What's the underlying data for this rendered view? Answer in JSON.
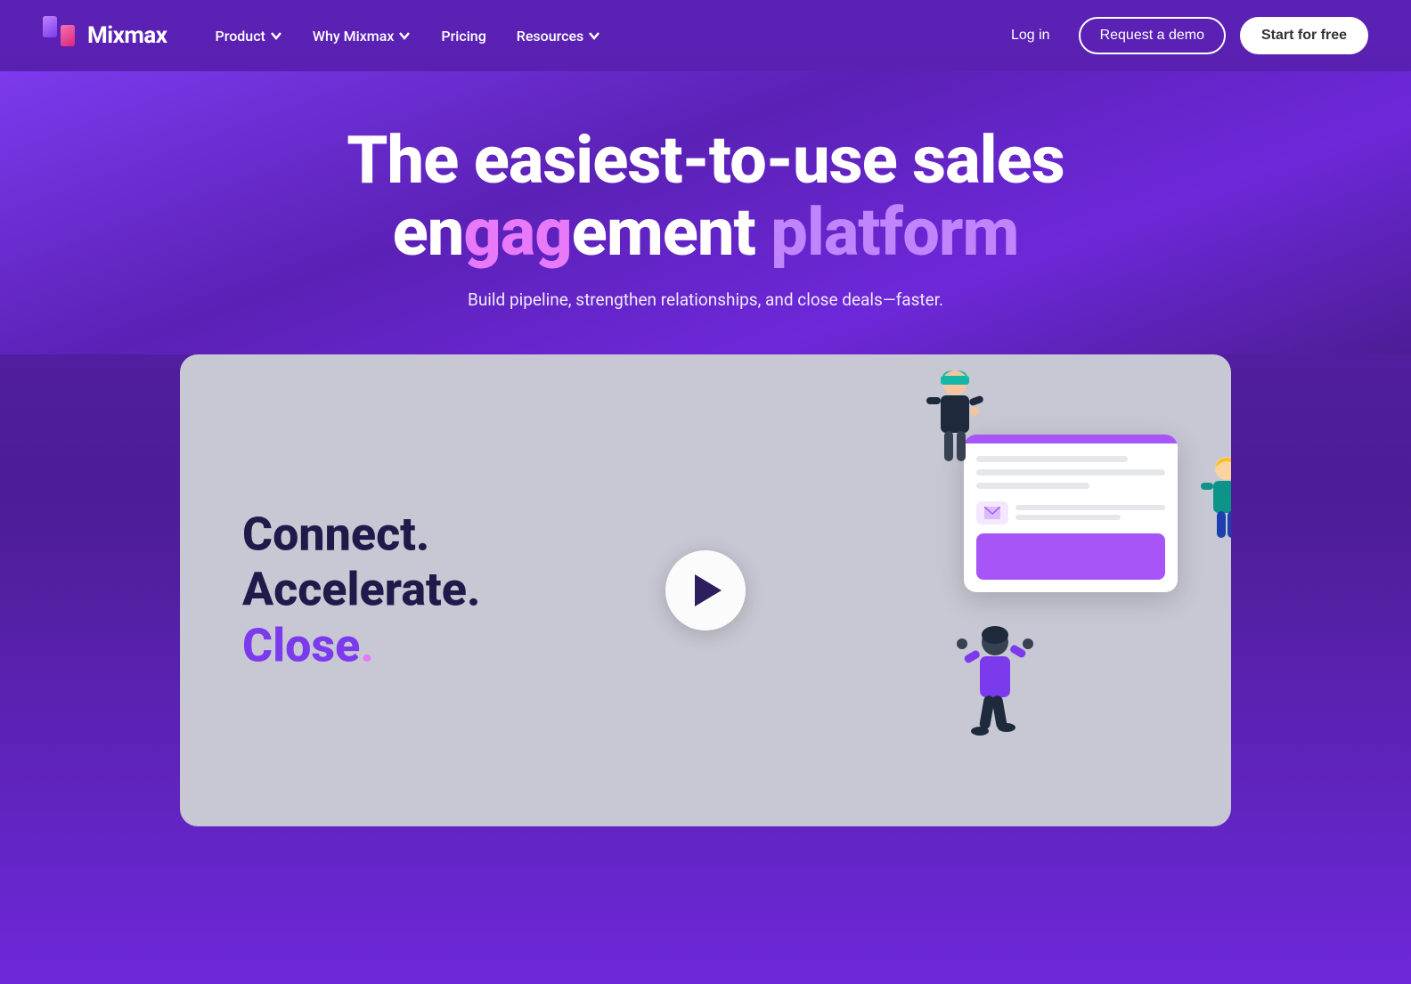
{
  "brand": {
    "name": "Mixmax",
    "logo_alt": "Mixmax logo"
  },
  "nav": {
    "links": [
      {
        "id": "product",
        "label": "Product",
        "hasDropdown": true
      },
      {
        "id": "why-mixmax",
        "label": "Why Mixmax",
        "hasDropdown": true
      },
      {
        "id": "pricing",
        "label": "Pricing",
        "hasDropdown": false
      },
      {
        "id": "resources",
        "label": "Resources",
        "hasDropdown": true
      }
    ],
    "login_label": "Log in",
    "demo_label": "Request a demo",
    "start_label": "Start for free"
  },
  "hero": {
    "headline_line1": "The easiest-to-use sales",
    "headline_eng_normal": "en",
    "headline_eng_highlight": "gag",
    "headline_eng_normal2": "ement ",
    "headline_platform": "platform",
    "subtitle": "Build pipeline, strengthen relationships, and close deals—faster."
  },
  "video_card": {
    "line1": "Connect.",
    "line2": "Accelerate.",
    "line3_main": "Close",
    "line3_dot": ".",
    "play_label": "Play video"
  }
}
